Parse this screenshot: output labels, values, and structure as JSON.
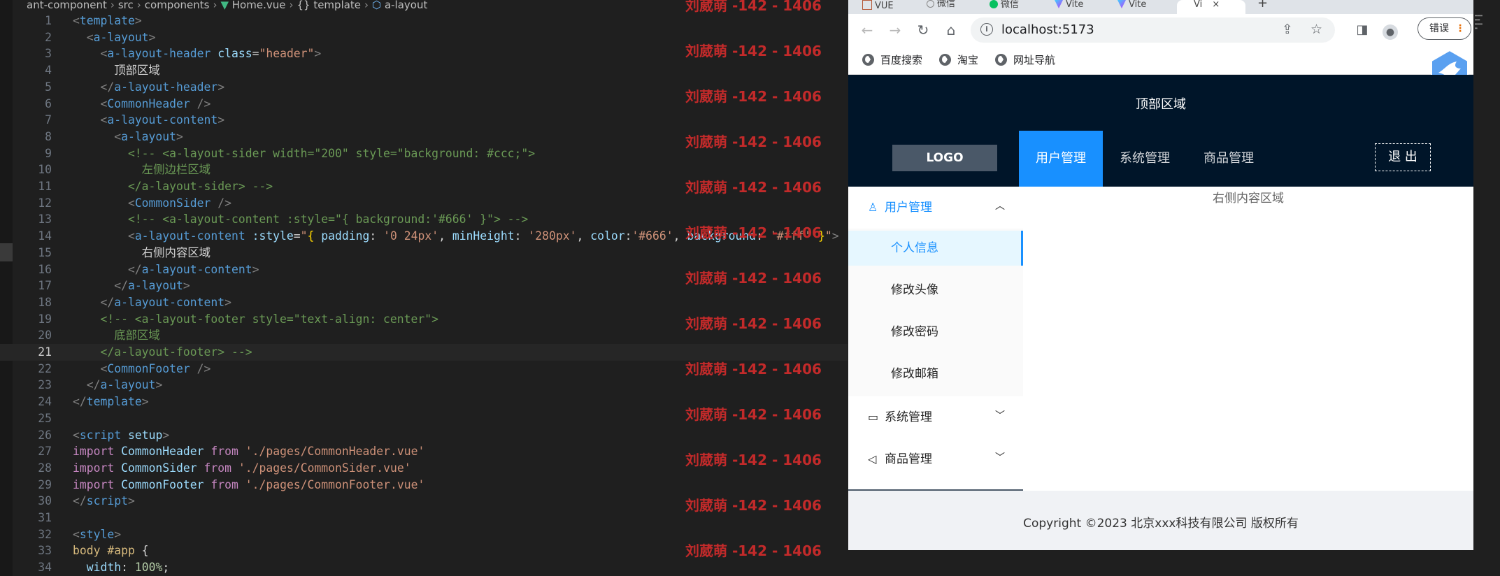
{
  "editor": {
    "breadcrumb": [
      "ant-component",
      "src",
      "components",
      "Home.vue",
      "{} template",
      "a-layout"
    ],
    "active_line": 21,
    "watermark_text": "刘葳萌 -142 - 1406",
    "lines": [
      {
        "num": "1",
        "tokens": [
          {
            "t": "<",
            "c": "c-ang"
          },
          {
            "t": "template",
            "c": "c-tag"
          },
          {
            "t": ">",
            "c": "c-ang"
          }
        ]
      },
      {
        "num": "2",
        "tokens": [
          {
            "t": "  <",
            "c": "c-ang"
          },
          {
            "t": "a-layout",
            "c": "c-tag"
          },
          {
            "t": ">",
            "c": "c-ang"
          }
        ]
      },
      {
        "num": "3",
        "tokens": [
          {
            "t": "    <",
            "c": "c-ang"
          },
          {
            "t": "a-layout-header",
            "c": "c-tag"
          },
          {
            "t": " ",
            "c": "c-plain"
          },
          {
            "t": "class",
            "c": "c-attr"
          },
          {
            "t": "=",
            "c": "c-plain"
          },
          {
            "t": "\"header\"",
            "c": "c-str"
          },
          {
            "t": ">",
            "c": "c-ang"
          }
        ]
      },
      {
        "num": "4",
        "tokens": [
          {
            "t": "      顶部区域",
            "c": "c-plain"
          }
        ]
      },
      {
        "num": "5",
        "tokens": [
          {
            "t": "    </",
            "c": "c-ang"
          },
          {
            "t": "a-layout-header",
            "c": "c-tag"
          },
          {
            "t": ">",
            "c": "c-ang"
          }
        ]
      },
      {
        "num": "6",
        "tokens": [
          {
            "t": "    <",
            "c": "c-ang"
          },
          {
            "t": "CommonHeader",
            "c": "c-tag"
          },
          {
            "t": " />",
            "c": "c-ang"
          }
        ]
      },
      {
        "num": "7",
        "tokens": [
          {
            "t": "    <",
            "c": "c-ang"
          },
          {
            "t": "a-layout-content",
            "c": "c-tag"
          },
          {
            "t": ">",
            "c": "c-ang"
          }
        ]
      },
      {
        "num": "8",
        "tokens": [
          {
            "t": "      <",
            "c": "c-ang"
          },
          {
            "t": "a-layout",
            "c": "c-tag"
          },
          {
            "t": ">",
            "c": "c-ang"
          }
        ]
      },
      {
        "num": "9",
        "tokens": [
          {
            "t": "        <!-- <a-layout-sider width=\"200\" style=\"background: #ccc;\">",
            "c": "c-com"
          }
        ]
      },
      {
        "num": "10",
        "tokens": [
          {
            "t": "          左侧边栏区域",
            "c": "c-com"
          }
        ]
      },
      {
        "num": "11",
        "tokens": [
          {
            "t": "        </a-layout-sider> -->",
            "c": "c-com"
          }
        ]
      },
      {
        "num": "12",
        "tokens": [
          {
            "t": "        <",
            "c": "c-ang"
          },
          {
            "t": "CommonSider",
            "c": "c-tag"
          },
          {
            "t": " />",
            "c": "c-ang"
          }
        ]
      },
      {
        "num": "13",
        "tokens": [
          {
            "t": "        <!-- <a-layout-content :style=\"{ background:'#666' }\"> -->",
            "c": "c-com"
          }
        ]
      },
      {
        "num": "14",
        "tokens": [
          {
            "t": "        <",
            "c": "c-ang"
          },
          {
            "t": "a-layout-content",
            "c": "c-tag"
          },
          {
            "t": " ",
            "c": "c-plain"
          },
          {
            "t": ":style",
            "c": "c-attr"
          },
          {
            "t": "=",
            "c": "c-plain"
          },
          {
            "t": "\"",
            "c": "c-str"
          },
          {
            "t": "{",
            "c": "c-punc"
          },
          {
            "t": " ",
            "c": "c-plain"
          },
          {
            "t": "padding",
            "c": "c-var"
          },
          {
            "t": ": ",
            "c": "c-plain"
          },
          {
            "t": "'0 24px'",
            "c": "c-str"
          },
          {
            "t": ", ",
            "c": "c-plain"
          },
          {
            "t": "minHeight",
            "c": "c-var"
          },
          {
            "t": ": ",
            "c": "c-plain"
          },
          {
            "t": "'280px'",
            "c": "c-str"
          },
          {
            "t": ", ",
            "c": "c-plain"
          },
          {
            "t": "color",
            "c": "c-var"
          },
          {
            "t": ":",
            "c": "c-plain"
          },
          {
            "t": "'#666'",
            "c": "c-str"
          },
          {
            "t": ", ",
            "c": "c-plain"
          },
          {
            "t": "background",
            "c": "c-var"
          },
          {
            "t": ": ",
            "c": "c-plain"
          },
          {
            "t": "'#fff'",
            "c": "c-str"
          },
          {
            "t": " ",
            "c": "c-plain"
          },
          {
            "t": "}",
            "c": "c-punc"
          },
          {
            "t": "\"",
            "c": "c-str"
          },
          {
            "t": ">",
            "c": "c-ang"
          }
        ]
      },
      {
        "num": "15",
        "tokens": [
          {
            "t": "          右侧内容区域",
            "c": "c-plain"
          }
        ]
      },
      {
        "num": "16",
        "tokens": [
          {
            "t": "        </",
            "c": "c-ang"
          },
          {
            "t": "a-layout-content",
            "c": "c-tag"
          },
          {
            "t": ">",
            "c": "c-ang"
          }
        ]
      },
      {
        "num": "17",
        "tokens": [
          {
            "t": "      </",
            "c": "c-ang"
          },
          {
            "t": "a-layout",
            "c": "c-tag"
          },
          {
            "t": ">",
            "c": "c-ang"
          }
        ]
      },
      {
        "num": "18",
        "tokens": [
          {
            "t": "    </",
            "c": "c-ang"
          },
          {
            "t": "a-layout-content",
            "c": "c-tag"
          },
          {
            "t": ">",
            "c": "c-ang"
          }
        ]
      },
      {
        "num": "19",
        "tokens": [
          {
            "t": "    <!-- <a-layout-footer style=\"text-align: center\">",
            "c": "c-com"
          }
        ]
      },
      {
        "num": "20",
        "tokens": [
          {
            "t": "      底部区域",
            "c": "c-com"
          }
        ]
      },
      {
        "num": "21",
        "tokens": [
          {
            "t": "    </a-layout-footer> -->",
            "c": "c-com"
          }
        ]
      },
      {
        "num": "22",
        "tokens": [
          {
            "t": "    <",
            "c": "c-ang"
          },
          {
            "t": "CommonFooter",
            "c": "c-tag"
          },
          {
            "t": " />",
            "c": "c-ang"
          }
        ]
      },
      {
        "num": "23",
        "tokens": [
          {
            "t": "  </",
            "c": "c-ang"
          },
          {
            "t": "a-layout",
            "c": "c-tag"
          },
          {
            "t": ">",
            "c": "c-ang"
          }
        ]
      },
      {
        "num": "24",
        "tokens": [
          {
            "t": "</",
            "c": "c-ang"
          },
          {
            "t": "template",
            "c": "c-tag"
          },
          {
            "t": ">",
            "c": "c-ang"
          }
        ]
      },
      {
        "num": "25",
        "tokens": []
      },
      {
        "num": "26",
        "tokens": [
          {
            "t": "<",
            "c": "c-ang"
          },
          {
            "t": "script",
            "c": "c-tag"
          },
          {
            "t": " ",
            "c": "c-plain"
          },
          {
            "t": "setup",
            "c": "c-attr"
          },
          {
            "t": ">",
            "c": "c-ang"
          }
        ]
      },
      {
        "num": "27",
        "tokens": [
          {
            "t": "import",
            "c": "c-key"
          },
          {
            "t": " ",
            "c": "c-plain"
          },
          {
            "t": "CommonHeader",
            "c": "c-var"
          },
          {
            "t": " ",
            "c": "c-plain"
          },
          {
            "t": "from",
            "c": "c-key"
          },
          {
            "t": " ",
            "c": "c-plain"
          },
          {
            "t": "'./pages/CommonHeader.vue'",
            "c": "c-str"
          }
        ]
      },
      {
        "num": "28",
        "tokens": [
          {
            "t": "import",
            "c": "c-key"
          },
          {
            "t": " ",
            "c": "c-plain"
          },
          {
            "t": "CommonSider",
            "c": "c-var"
          },
          {
            "t": " ",
            "c": "c-plain"
          },
          {
            "t": "from",
            "c": "c-key"
          },
          {
            "t": " ",
            "c": "c-plain"
          },
          {
            "t": "'./pages/CommonSider.vue'",
            "c": "c-str"
          }
        ]
      },
      {
        "num": "29",
        "tokens": [
          {
            "t": "import",
            "c": "c-key"
          },
          {
            "t": " ",
            "c": "c-plain"
          },
          {
            "t": "CommonFooter",
            "c": "c-var"
          },
          {
            "t": " ",
            "c": "c-plain"
          },
          {
            "t": "from",
            "c": "c-key"
          },
          {
            "t": " ",
            "c": "c-plain"
          },
          {
            "t": "'./pages/CommonFooter.vue'",
            "c": "c-str"
          }
        ]
      },
      {
        "num": "30",
        "tokens": [
          {
            "t": "</",
            "c": "c-ang"
          },
          {
            "t": "script",
            "c": "c-tag"
          },
          {
            "t": ">",
            "c": "c-ang"
          }
        ]
      },
      {
        "num": "31",
        "tokens": []
      },
      {
        "num": "32",
        "tokens": [
          {
            "t": "<",
            "c": "c-ang"
          },
          {
            "t": "style",
            "c": "c-tag"
          },
          {
            "t": ">",
            "c": "c-ang"
          }
        ]
      },
      {
        "num": "33",
        "tokens": [
          {
            "t": "body #app",
            "c": "c-sel"
          },
          {
            "t": " {",
            "c": "c-plain"
          }
        ]
      },
      {
        "num": "34",
        "tokens": [
          {
            "t": "  ",
            "c": "c-plain"
          },
          {
            "t": "width",
            "c": "c-var"
          },
          {
            "t": ": ",
            "c": "c-plain"
          },
          {
            "t": "100%",
            "c": "c-num"
          },
          {
            "t": ";",
            "c": "c-plain"
          }
        ]
      }
    ]
  },
  "browser": {
    "tabs": [
      {
        "label": "VUE",
        "favicon_color": "#e34c26"
      },
      {
        "label": "微信",
        "favicon_color": "#888888"
      },
      {
        "label": "微信",
        "favicon_color": "#07c160"
      },
      {
        "label": "Vite",
        "favicon_color": "#a855f7"
      },
      {
        "label": "Vite",
        "favicon_color": "#a855f7"
      },
      {
        "label": "Vi",
        "favicon_color": "#a855f7"
      }
    ],
    "tab_close_glyph": "×",
    "new_tab_glyph": "+",
    "url": "localhost:5173",
    "error_button_label": "错误",
    "bookmarks": [
      "百度搜索",
      "淘宝",
      "网址导航"
    ],
    "page": {
      "header_title": "顶部区域",
      "logo": "LOGO",
      "top_menu": [
        {
          "label": "用户管理",
          "active": true
        },
        {
          "label": "系统管理",
          "active": false
        },
        {
          "label": "商品管理",
          "active": false
        }
      ],
      "logout_label": "退 出",
      "sider": {
        "open_group": "用户管理",
        "open_items": [
          "个人信息",
          "修改头像",
          "修改密码",
          "修改邮箱"
        ],
        "selected_item": "个人信息",
        "closed_groups": [
          "系统管理",
          "商品管理"
        ]
      },
      "content_text": "右侧内容区域",
      "footer_text": "Copyright ©2023 北京xxx科技有限公司 版权所有"
    },
    "colors": {
      "header_bg": "#001529",
      "primary": "#1890ff",
      "selected_bg": "#e6f7ff",
      "footer_bg": "#f0f2f5"
    }
  }
}
